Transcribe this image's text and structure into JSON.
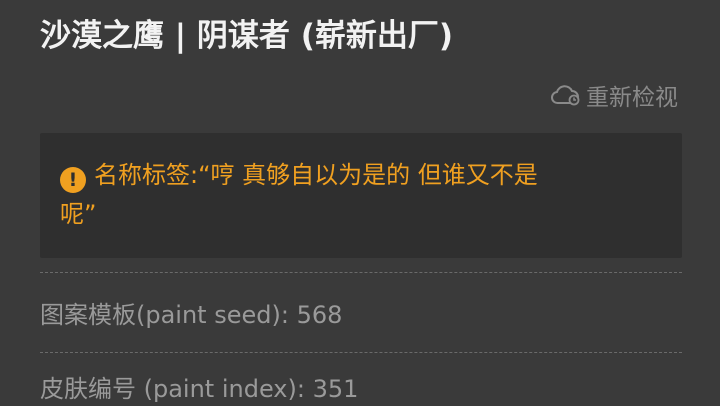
{
  "item": {
    "title": "沙漠之鹰 | 阴谋者 (崭新出厂)"
  },
  "actions": {
    "reinspect_label": "重新检视",
    "reinspect_icon": "cloud-refresh-icon"
  },
  "name_tag": {
    "icon": "exclamation-circle-icon",
    "line1": "名称标签:“哼 真够自以为是的 但谁又不是",
    "line2": "呢”",
    "color": "#f0a020"
  },
  "details": [
    {
      "label": "图案模板(paint seed):",
      "value": "568"
    },
    {
      "label": "皮肤编号 (paint index):",
      "value": "351"
    }
  ]
}
